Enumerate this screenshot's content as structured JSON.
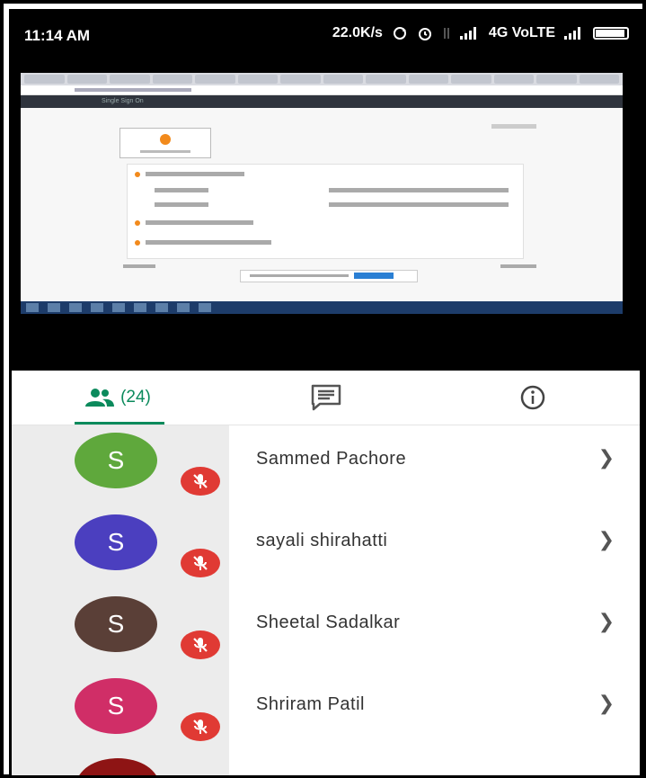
{
  "status_bar": {
    "time": "11:14 AM",
    "network_speed": "22.0K/s",
    "network_type": "4G VoLTE",
    "icons": [
      "sync-icon",
      "alarm-icon",
      "data-arrows-icon",
      "signal-icon",
      "signal-icon",
      "battery-icon"
    ]
  },
  "shared_screen": {
    "page_title": "Single Sign On",
    "search_label": "Search"
  },
  "tabs": {
    "people_count": "(24)",
    "people_icon": "people-icon",
    "chat_icon": "chat-icon",
    "info_icon": "info-icon"
  },
  "participants": [
    {
      "initial": "S",
      "name": "Sammed Pachore",
      "color": "#5fa83c",
      "muted": true
    },
    {
      "initial": "S",
      "name": "sayali shirahatti",
      "color": "#4b3fbf",
      "muted": true
    },
    {
      "initial": "S",
      "name": "Sheetal Sadalkar",
      "color": "#5a3f37",
      "muted": true
    },
    {
      "initial": "S",
      "name": "Shriram Patil",
      "color": "#d02e67",
      "muted": true
    }
  ],
  "colors": {
    "accent": "#0b8a5c",
    "mute_badge": "#e03a34",
    "partial_avatar": "#8e1414"
  }
}
